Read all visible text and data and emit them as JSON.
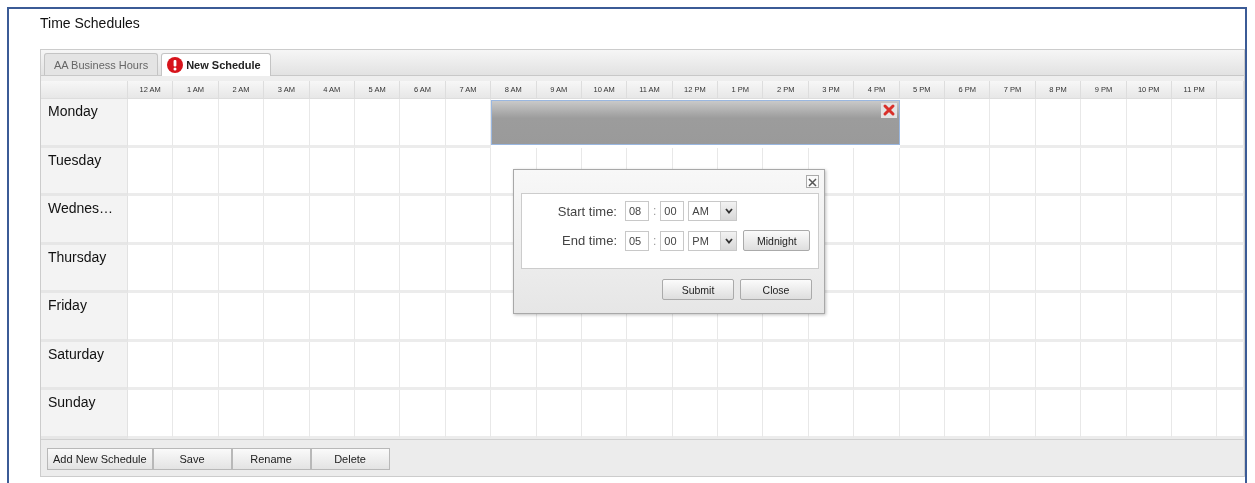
{
  "page": {
    "title": "Time Schedules"
  },
  "tabs": [
    {
      "label": "AA Business Hours",
      "selected": false,
      "has_error": false
    },
    {
      "label": "New Schedule",
      "selected": true,
      "has_error": true
    }
  ],
  "grid": {
    "hours": [
      "12 AM",
      "1 AM",
      "2 AM",
      "3 AM",
      "4 AM",
      "5 AM",
      "6 AM",
      "7 AM",
      "8 AM",
      "9 AM",
      "10 AM",
      "11 AM",
      "12 PM",
      "1 PM",
      "2 PM",
      "3 PM",
      "4 PM",
      "5 PM",
      "6 PM",
      "7 PM",
      "8 PM",
      "9 PM",
      "10 PM",
      "11 PM"
    ],
    "days": [
      {
        "name": "Monday",
        "hours_selected": [
          false,
          false,
          false,
          false,
          false,
          false,
          false,
          false,
          true,
          true,
          true,
          true,
          true,
          true,
          true,
          true,
          true,
          false,
          false,
          false,
          false,
          false,
          false,
          false
        ]
      },
      {
        "name": "Tuesday",
        "hours_selected": [
          false,
          false,
          false,
          false,
          false,
          false,
          false,
          false,
          false,
          false,
          false,
          false,
          false,
          false,
          false,
          false,
          false,
          false,
          false,
          false,
          false,
          false,
          false,
          false
        ]
      },
      {
        "name": "Wednes…",
        "hours_selected": [
          false,
          false,
          false,
          false,
          false,
          false,
          false,
          false,
          false,
          false,
          false,
          false,
          false,
          false,
          false,
          false,
          false,
          false,
          false,
          false,
          false,
          false,
          false,
          false
        ]
      },
      {
        "name": "Thursday",
        "hours_selected": [
          false,
          false,
          false,
          false,
          false,
          false,
          false,
          false,
          false,
          false,
          false,
          false,
          false,
          false,
          false,
          false,
          false,
          false,
          false,
          false,
          false,
          false,
          false,
          false
        ]
      },
      {
        "name": "Friday",
        "hours_selected": [
          false,
          false,
          false,
          false,
          false,
          false,
          false,
          false,
          false,
          false,
          false,
          false,
          false,
          false,
          false,
          false,
          false,
          false,
          false,
          false,
          false,
          false,
          false,
          false
        ]
      },
      {
        "name": "Saturday",
        "hours_selected": [
          false,
          false,
          false,
          false,
          false,
          false,
          false,
          false,
          false,
          false,
          false,
          false,
          false,
          false,
          false,
          false,
          false,
          false,
          false,
          false,
          false,
          false,
          false,
          false
        ]
      },
      {
        "name": "Sunday",
        "hours_selected": [
          false,
          false,
          false,
          false,
          false,
          false,
          false,
          false,
          false,
          false,
          false,
          false,
          false,
          false,
          false,
          false,
          false,
          false,
          false,
          false,
          false,
          false,
          false,
          false
        ]
      }
    ]
  },
  "dialog": {
    "rows": [
      {
        "label": "Start time:",
        "hour": "08",
        "separator": ":",
        "minute": "00",
        "period": "AM"
      },
      {
        "label": "End time:",
        "hour": "05",
        "separator": ":",
        "minute": "00",
        "period": "PM",
        "extra_button": "Midnight"
      }
    ],
    "buttons": [
      "Submit",
      "Close"
    ]
  },
  "toolbar": {
    "buttons": [
      "Add New Schedule",
      "Save",
      "Rename",
      "Delete"
    ]
  }
}
